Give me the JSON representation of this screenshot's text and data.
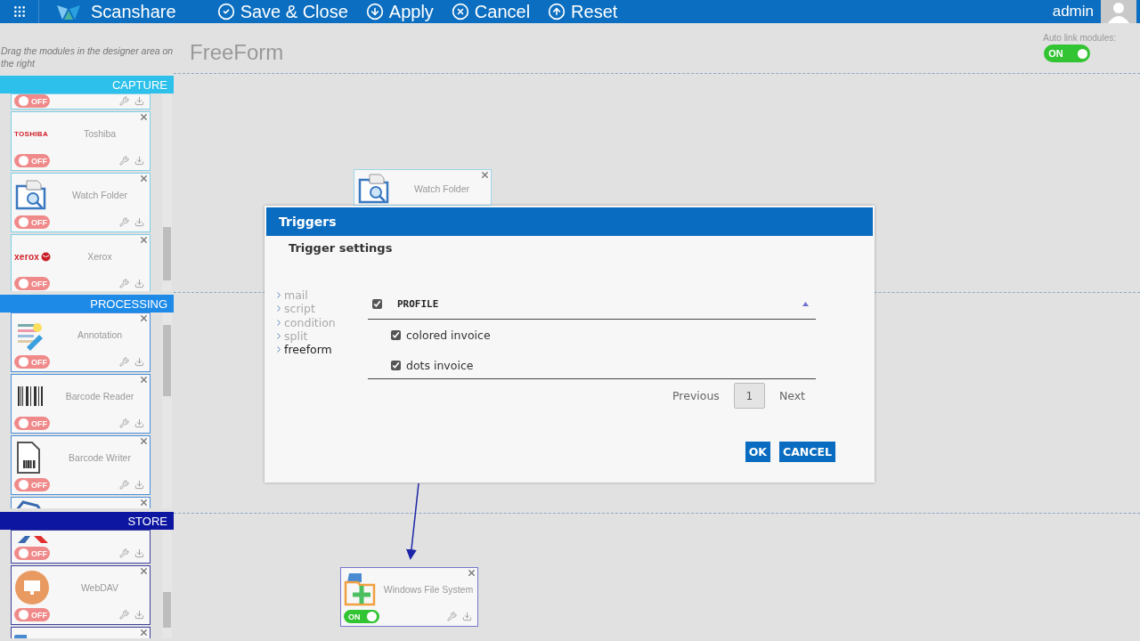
{
  "topbar": {
    "app_name": "Scanshare",
    "actions": [
      {
        "kind": "save",
        "label": "Save & Close"
      },
      {
        "kind": "apply",
        "label": "Apply"
      },
      {
        "kind": "cancel",
        "label": "Cancel"
      },
      {
        "kind": "reset",
        "label": "Reset"
      }
    ],
    "user": "admin"
  },
  "sidebar": {
    "hint": "Drag the modules in the designer area on the right",
    "sections": [
      {
        "kind": "capture",
        "title": "CAPTURE",
        "modules": [
          {
            "kind": "tail",
            "toggle": "OFF",
            "on": false
          },
          {
            "kind": "full",
            "logo": "TOSHIBA",
            "name": "Toshiba",
            "toggle": "OFF",
            "on": false
          },
          {
            "kind": "full",
            "name": "Watch Folder",
            "toggle": "OFF",
            "on": false
          },
          {
            "kind": "full",
            "logo": "xerox",
            "name": "Xerox",
            "toggle": "OFF",
            "on": false
          }
        ]
      },
      {
        "kind": "processing",
        "title": "PROCESSING",
        "modules": [
          {
            "kind": "full",
            "name": "Annotation",
            "toggle": "OFF",
            "on": false
          },
          {
            "kind": "full",
            "name": "Barcode Reader",
            "toggle": "OFF",
            "on": false
          },
          {
            "kind": "full",
            "name": "Barcode Writer",
            "toggle": "OFF",
            "on": false
          },
          {
            "kind": "head"
          }
        ]
      },
      {
        "kind": "store",
        "title": "STORE",
        "modules": [
          {
            "kind": "tail",
            "toggle": "OFF",
            "on": false
          },
          {
            "kind": "full",
            "name": "WebDAV",
            "toggle": "OFF",
            "on": false
          },
          {
            "kind": "head"
          }
        ]
      }
    ]
  },
  "canvas": {
    "title": "FreeForm",
    "auto_link": {
      "label": "Auto link modules:",
      "toggle": "ON",
      "on": true
    },
    "nodes": [
      {
        "kind": "partial",
        "name": "Watch Folder"
      },
      {
        "kind": "full",
        "name": "Windows File System",
        "toggle": "ON",
        "on": true
      }
    ]
  },
  "dialog": {
    "title": "Triggers",
    "subtitle": "Trigger settings",
    "nav": [
      {
        "label": "mail",
        "selected": false
      },
      {
        "label": "script",
        "selected": false
      },
      {
        "label": "condition",
        "selected": false
      },
      {
        "label": "split",
        "selected": false
      },
      {
        "label": "freeform",
        "selected": true
      }
    ],
    "table": {
      "header": {
        "label": "PROFILE",
        "checked": true
      },
      "rows": [
        {
          "label": "colored invoice",
          "checked": true
        },
        {
          "label": "dots invoice",
          "checked": true
        }
      ]
    },
    "pagination": {
      "previous": "Previous",
      "pages": [
        {
          "label": "1",
          "selected": true
        }
      ],
      "next": "Next"
    },
    "buttons": [
      "OK",
      "CANCEL"
    ]
  }
}
